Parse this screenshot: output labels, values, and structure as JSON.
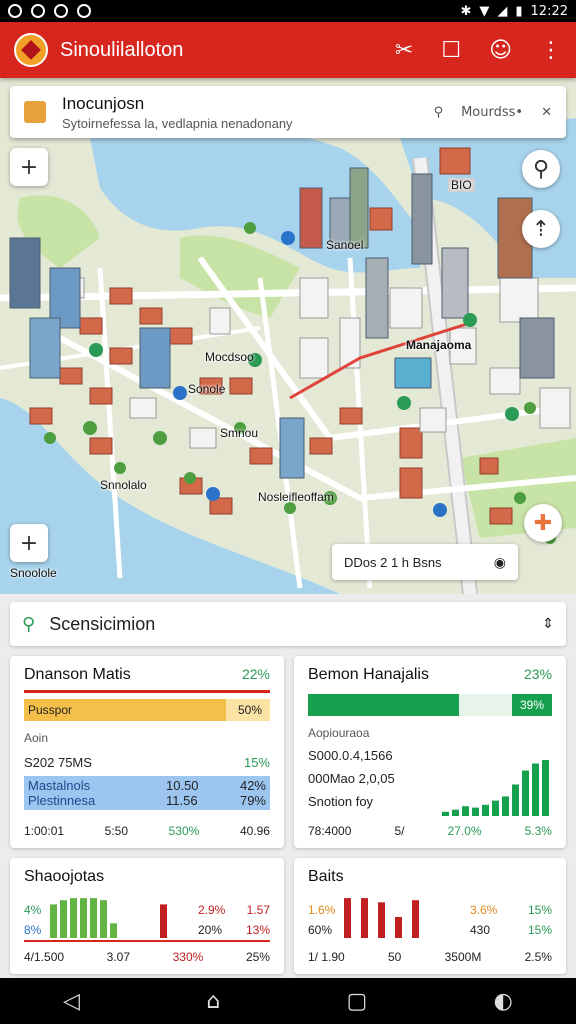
{
  "status_bar": {
    "time": "12:22"
  },
  "app_bar": {
    "title": "Sinoulilalloton"
  },
  "map": {
    "search_title": "Inocunjosn",
    "search_subtitle": "Sytoirnefessa la, vedlapnia nenadonany",
    "search_mode": "Mourdss•",
    "labels": [
      "Sanoel",
      "Mocdsoo",
      "Sonole",
      "Smnou",
      "Snnolalo",
      "Manajaoma",
      "Nosleifleoffam",
      "Snoolole"
    ],
    "tag_label": "BIO",
    "chip_text": "DDos 2 1 h Bsns"
  },
  "search_panel": {
    "label": "Scensicimion"
  },
  "card1": {
    "title": "Dnanson Matis",
    "pct": "22%",
    "bar_label": "Pusspor",
    "bar_value": "50%",
    "bar_fill": 0.82,
    "small_label": "Aoin",
    "stat_label": "S202 75MS",
    "stat_value": "15%",
    "rows": [
      {
        "name": "Mastalnols",
        "a": "10.50",
        "b": "42%"
      },
      {
        "name": "Plestinnesa",
        "a": "11.56",
        "b": "79%"
      }
    ],
    "footer": [
      "1:00:01",
      "5:50",
      "530%",
      "40.96"
    ]
  },
  "card2": {
    "title": "Bemon Hanajalis",
    "pct": "23%",
    "bar_value": "39%",
    "bar_fill": 0.62,
    "small_label": "Aopiouraoa",
    "stat1": "S000.0.4,1566",
    "stat2": "000Mao 2,0,05",
    "stat3": "Snotion foy",
    "bars": [
      0.06,
      0.09,
      0.14,
      0.12,
      0.16,
      0.22,
      0.28,
      0.45,
      0.65,
      0.75,
      0.8
    ],
    "footer": [
      "78:4000",
      "5/",
      "27.0%",
      "5.3%"
    ]
  },
  "card3": {
    "title": "Shaoojotas",
    "left_top": "4%",
    "left_bottom": "8%",
    "mid_top": "2.9%",
    "mid_bottom": "20%",
    "right_top": "1.57",
    "right_bottom": "13%",
    "green_bars": [
      0.8,
      0.9,
      0.95,
      0.95,
      0.95,
      0.9,
      0.35
    ],
    "red_bars": [
      0.8
    ],
    "footer": [
      "4/1.500",
      "3.07",
      "330%",
      "25%"
    ]
  },
  "card4": {
    "title": "Baits",
    "left_top": "1.6%",
    "left_bottom": "60%",
    "mid_top": "3.6%",
    "mid_bottom": "430",
    "right_top": "15%",
    "right_bottom": "15%",
    "red_bars": [
      0.95,
      0.95,
      0.85,
      0.5,
      0.9
    ],
    "footer": [
      "1/ 1.90",
      "50",
      "3500M",
      "2.5%"
    ]
  }
}
